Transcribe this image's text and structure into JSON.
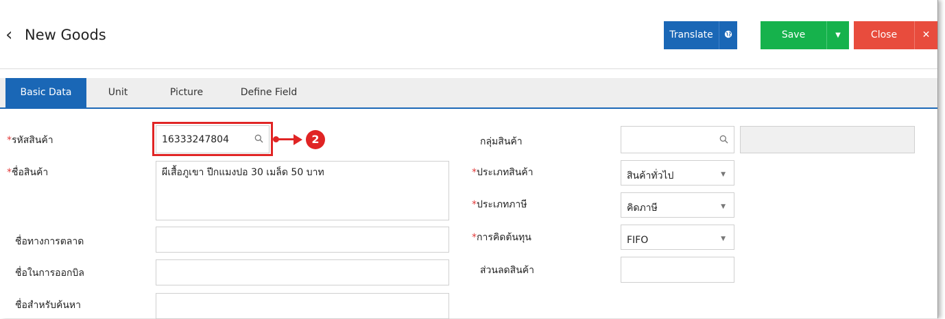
{
  "header": {
    "back_icon": "‹",
    "title": "New Goods",
    "translate_label": "Translate",
    "translate_icon": "globe-icon",
    "save_label": "Save",
    "save_icon": "caret-down-icon",
    "close_label": "Close",
    "close_icon": "close-icon"
  },
  "colors": {
    "primary": "#1a67b6",
    "save": "#16b24c",
    "close": "#e84c3d",
    "required": "#e23b3b",
    "annotation": "#e02424"
  },
  "tabs": [
    {
      "label": "Basic Data",
      "active": true
    },
    {
      "label": "Unit"
    },
    {
      "label": "Picture"
    },
    {
      "label": "Define Field"
    }
  ],
  "form": {
    "product_code": {
      "label": "รหัสสินค้า",
      "value": "16333247804"
    },
    "product_name": {
      "label": "ชื่อสินค้า",
      "value": "ผีเสื้อภูเขา ปีกแมงปอ 30 เมล็ด 50 บาท"
    },
    "marketing_name": {
      "label": "ชื่อทางการตลาด",
      "value": ""
    },
    "billing_name": {
      "label": "ชื่อในการออกบิล",
      "value": ""
    },
    "search_name": {
      "label": "ชื่อสำหรับค้นหา",
      "value": ""
    },
    "product_group": {
      "label": "กลุ่มสินค้า",
      "value": "",
      "name_value": ""
    },
    "product_type": {
      "label": "ประเภทสินค้า",
      "value": "สินค้าทั่วไป"
    },
    "tax_type": {
      "label": "ประเภทภาษี",
      "value": "คิดภาษี"
    },
    "costing": {
      "label": "การคิดต้นทุน",
      "value": "FIFO"
    },
    "discount": {
      "label": "ส่วนลดสินค้า",
      "value": ""
    }
  },
  "annotation": {
    "step": "2"
  }
}
